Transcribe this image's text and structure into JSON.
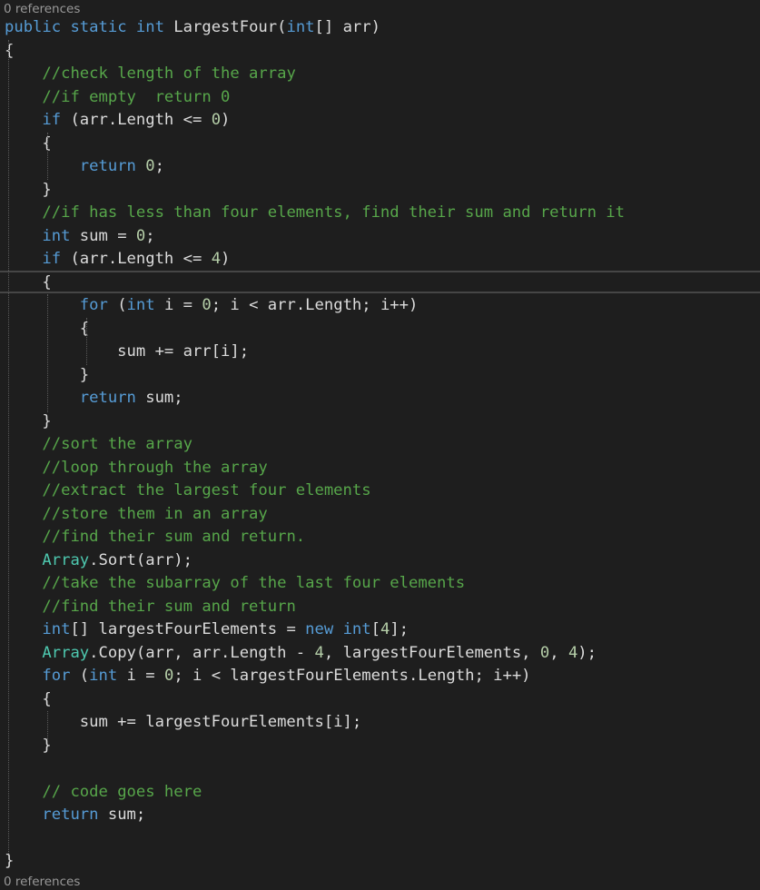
{
  "editor": {
    "code_lens_top": "0 references",
    "code_lens_bottom": "0 references",
    "lines": [
      [
        [
          "kw",
          "public"
        ],
        [
          "tx",
          " "
        ],
        [
          "kw",
          "static"
        ],
        [
          "tx",
          " "
        ],
        [
          "kw",
          "int"
        ],
        [
          "tx",
          " LargestFour("
        ],
        [
          "kw",
          "int"
        ],
        [
          "tx",
          "[] arr)"
        ]
      ],
      [
        [
          "tx",
          "{"
        ]
      ],
      [
        [
          "tx",
          "    "
        ],
        [
          "cm",
          "//check length of the array"
        ]
      ],
      [
        [
          "tx",
          "    "
        ],
        [
          "cm",
          "//if empty  return 0"
        ]
      ],
      [
        [
          "tx",
          "    "
        ],
        [
          "kw",
          "if"
        ],
        [
          "tx",
          " (arr.Length <= "
        ],
        [
          "nm",
          "0"
        ],
        [
          "tx",
          ")"
        ]
      ],
      [
        [
          "tx",
          "    {"
        ]
      ],
      [
        [
          "tx",
          "        "
        ],
        [
          "kw",
          "return"
        ],
        [
          "tx",
          " "
        ],
        [
          "nm",
          "0"
        ],
        [
          "tx",
          ";"
        ]
      ],
      [
        [
          "tx",
          "    }"
        ]
      ],
      [
        [
          "tx",
          "    "
        ],
        [
          "cm",
          "//if has less than four elements, find their sum and return it"
        ]
      ],
      [
        [
          "tx",
          "    "
        ],
        [
          "kw",
          "int"
        ],
        [
          "tx",
          " sum = "
        ],
        [
          "nm",
          "0"
        ],
        [
          "tx",
          ";"
        ]
      ],
      [
        [
          "tx",
          "    "
        ],
        [
          "kw",
          "if"
        ],
        [
          "tx",
          " (arr.Length <= "
        ],
        [
          "nm",
          "4"
        ],
        [
          "tx",
          ")"
        ]
      ],
      [
        [
          "tx",
          "    {"
        ]
      ],
      [
        [
          "tx",
          "        "
        ],
        [
          "kw",
          "for"
        ],
        [
          "tx",
          " ("
        ],
        [
          "kw",
          "int"
        ],
        [
          "tx",
          " i = "
        ],
        [
          "nm",
          "0"
        ],
        [
          "tx",
          "; i < arr.Length; i++)"
        ]
      ],
      [
        [
          "tx",
          "        {"
        ]
      ],
      [
        [
          "tx",
          "            sum += arr[i];"
        ]
      ],
      [
        [
          "tx",
          "        }"
        ]
      ],
      [
        [
          "tx",
          "        "
        ],
        [
          "kw",
          "return"
        ],
        [
          "tx",
          " sum;"
        ]
      ],
      [
        [
          "tx",
          "    }"
        ]
      ],
      [
        [
          "tx",
          "    "
        ],
        [
          "cm",
          "//sort the array"
        ]
      ],
      [
        [
          "tx",
          "    "
        ],
        [
          "cm",
          "//loop through the array"
        ]
      ],
      [
        [
          "tx",
          "    "
        ],
        [
          "cm",
          "//extract the largest four elements"
        ]
      ],
      [
        [
          "tx",
          "    "
        ],
        [
          "cm",
          "//store them in an array"
        ]
      ],
      [
        [
          "tx",
          "    "
        ],
        [
          "cm",
          "//find their sum and return."
        ]
      ],
      [
        [
          "tx",
          "    "
        ],
        [
          "ty",
          "Array"
        ],
        [
          "tx",
          ".Sort(arr);"
        ]
      ],
      [
        [
          "tx",
          "    "
        ],
        [
          "cm",
          "//take the subarray of the last four elements"
        ]
      ],
      [
        [
          "tx",
          "    "
        ],
        [
          "cm",
          "//find their sum and return"
        ]
      ],
      [
        [
          "tx",
          "    "
        ],
        [
          "kw",
          "int"
        ],
        [
          "tx",
          "[] largestFourElements = "
        ],
        [
          "kw",
          "new"
        ],
        [
          "tx",
          " "
        ],
        [
          "kw",
          "int"
        ],
        [
          "tx",
          "["
        ],
        [
          "nm",
          "4"
        ],
        [
          "tx",
          "];"
        ]
      ],
      [
        [
          "tx",
          "    "
        ],
        [
          "ty",
          "Array"
        ],
        [
          "tx",
          ".Copy(arr, arr.Length - "
        ],
        [
          "nm",
          "4"
        ],
        [
          "tx",
          ", largestFourElements, "
        ],
        [
          "nm",
          "0"
        ],
        [
          "tx",
          ", "
        ],
        [
          "nm",
          "4"
        ],
        [
          "tx",
          ");"
        ]
      ],
      [
        [
          "tx",
          "    "
        ],
        [
          "kw",
          "for"
        ],
        [
          "tx",
          " ("
        ],
        [
          "kw",
          "int"
        ],
        [
          "tx",
          " i = "
        ],
        [
          "nm",
          "0"
        ],
        [
          "tx",
          "; i < largestFourElements.Length; i++)"
        ]
      ],
      [
        [
          "tx",
          "    {"
        ]
      ],
      [
        [
          "tx",
          "        sum += largestFourElements[i];"
        ]
      ],
      [
        [
          "tx",
          "    }"
        ]
      ],
      [
        [
          "tx",
          ""
        ]
      ],
      [
        [
          "tx",
          "    "
        ],
        [
          "cm",
          "// code goes here"
        ]
      ],
      [
        [
          "tx",
          "    "
        ],
        [
          "kw",
          "return"
        ],
        [
          "tx",
          " sum;"
        ]
      ],
      [
        [
          "tx",
          ""
        ]
      ],
      [
        [
          "tx",
          "}"
        ]
      ]
    ]
  }
}
